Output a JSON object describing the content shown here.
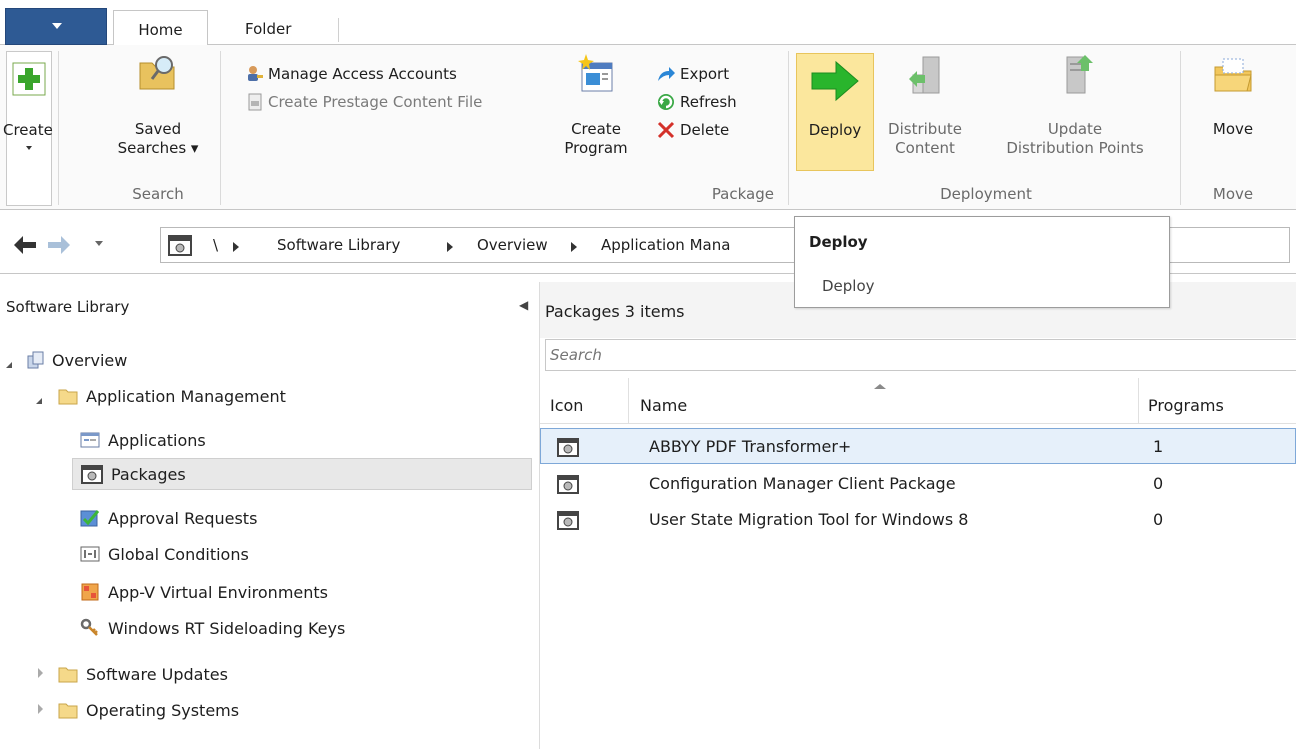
{
  "tabs": {
    "home": "Home",
    "folder": "Folder"
  },
  "ribbon": {
    "create": {
      "label": "Create",
      "icon": "add-icon"
    },
    "saved_searches": {
      "line1": "Saved",
      "line2": "Searches ▾",
      "icon": "saved-searches-icon"
    },
    "manage_access_accounts": {
      "label": "Manage Access Accounts",
      "icon": "user-key-icon"
    },
    "create_prestage": {
      "label": "Create Prestage Content File",
      "icon": "prestage-icon"
    },
    "create_program": {
      "line1": "Create",
      "line2": "Program",
      "icon": "new-program-icon"
    },
    "export": {
      "label": "Export",
      "icon": "export-arrow-icon"
    },
    "refresh": {
      "label": "Refresh",
      "icon": "refresh-icon"
    },
    "delete": {
      "label": "Delete",
      "icon": "delete-x-icon"
    },
    "deploy": {
      "label": "Deploy",
      "icon": "deploy-arrow-icon"
    },
    "distribute_content": {
      "line1": "Distribute",
      "line2": "Content",
      "icon": "distribute-content-icon"
    },
    "update_dp": {
      "line1": "Update",
      "line2": "Distribution Points",
      "icon": "update-dp-icon"
    },
    "move": {
      "label": "Move",
      "icon": "move-folder-icon"
    },
    "groups": {
      "search": "Search",
      "package": "Package",
      "deployment": "Deployment",
      "move": "Move"
    }
  },
  "address": {
    "root": "\\",
    "crumbs": [
      "Software Library",
      "Overview",
      "Application Mana"
    ]
  },
  "tooltip": {
    "title": "Deploy",
    "body": "Deploy"
  },
  "nav": {
    "title": "Software Library",
    "items": [
      {
        "label": "Overview"
      },
      {
        "label": "Application Management"
      },
      {
        "label": "Applications"
      },
      {
        "label": "Packages"
      },
      {
        "label": "Approval Requests"
      },
      {
        "label": "Global Conditions"
      },
      {
        "label": "App-V Virtual Environments"
      },
      {
        "label": "Windows RT Sideloading Keys"
      },
      {
        "label": "Software Updates"
      },
      {
        "label": "Operating Systems"
      }
    ]
  },
  "main": {
    "title": "Packages 3 items",
    "search_placeholder": "Search",
    "columns": {
      "icon": "Icon",
      "name": "Name",
      "programs": "Programs"
    },
    "rows": [
      {
        "name": "ABBYY PDF Transformer+",
        "programs": "1"
      },
      {
        "name": "Configuration Manager Client Package",
        "programs": "0"
      },
      {
        "name": "User State Migration Tool for Windows 8",
        "programs": "0"
      }
    ]
  },
  "colors": {
    "app_menu": "#2e5a94",
    "deploy_highlight": "#fbe79d",
    "selection": "#e6f0fa",
    "selection_border": "#7ea8d8"
  }
}
